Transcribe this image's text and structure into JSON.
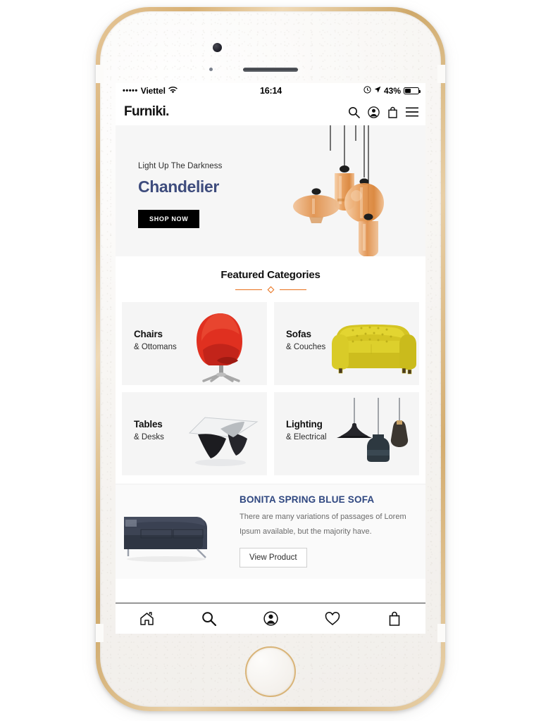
{
  "device": {
    "frame": "iphone-gold-white",
    "frame_color": "#d8b175"
  },
  "status_bar": {
    "signal_dots": "•••••",
    "carrier": "Viettel",
    "wifi_icon": "wifi-icon",
    "time": "16:14",
    "alarm_icon": "alarm-icon",
    "location_icon": "location-arrow-icon",
    "battery_percent": "43%",
    "battery_level": 43
  },
  "header": {
    "logo": "Furniki.",
    "icons": [
      {
        "name": "search-icon",
        "label": "Search"
      },
      {
        "name": "account-icon",
        "label": "Account"
      },
      {
        "name": "bag-icon",
        "label": "Cart"
      },
      {
        "name": "menu-icon",
        "label": "Menu"
      }
    ]
  },
  "hero": {
    "kicker": "Light Up The Darkness",
    "title": "Chandelier",
    "cta": "SHOP NOW",
    "title_color": "#3e4c7d",
    "background": "#f6f6f6",
    "image_alt": "amber glass pendant chandelier cluster"
  },
  "featured": {
    "title": "Featured Categories",
    "divider_color": "#e8701a",
    "categories": [
      {
        "name": "Chairs",
        "sub": "& Ottomans",
        "art": "red-egg-chair"
      },
      {
        "name": "Sofas",
        "sub": "& Couches",
        "art": "yellow-chesterfield-sofa"
      },
      {
        "name": "Tables",
        "sub": "& Desks",
        "art": "noguchi-coffee-table"
      },
      {
        "name": "Lighting",
        "sub": "& Electrical",
        "art": "black-pendant-lamps"
      }
    ]
  },
  "promo": {
    "title": "BONITA SPRING BLUE SOFA",
    "description": "There are many variations of passages of Lorem Ipsum available, but the majority have.",
    "button": "View Product",
    "title_color": "#2f4780",
    "image_alt": "dark navy blue three-seat sofa"
  },
  "tabbar": {
    "items": [
      {
        "name": "home-icon",
        "label": "Home"
      },
      {
        "name": "search-icon",
        "label": "Search"
      },
      {
        "name": "account-icon",
        "label": "Account"
      },
      {
        "name": "heart-icon",
        "label": "Wishlist"
      },
      {
        "name": "bag-icon",
        "label": "Bag"
      }
    ]
  }
}
